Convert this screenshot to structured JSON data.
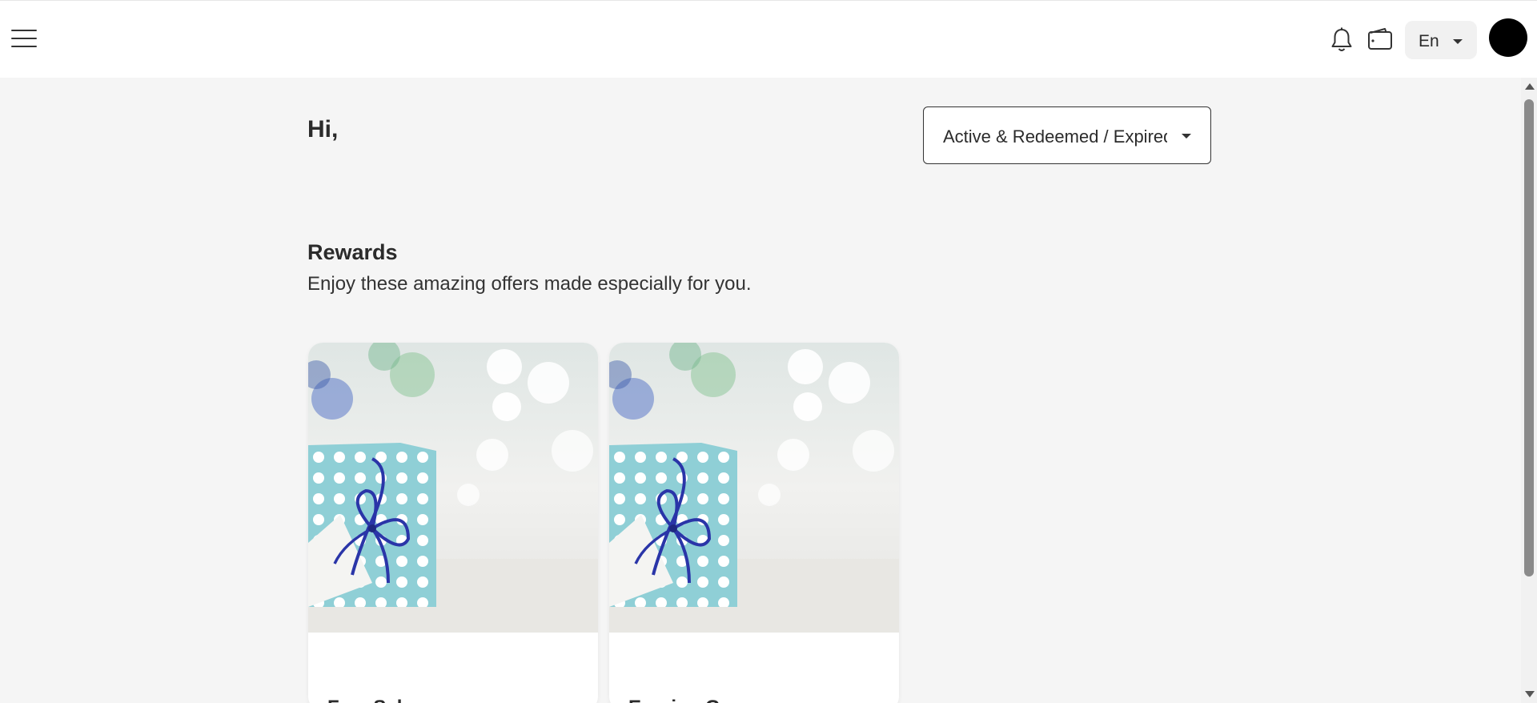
{
  "header": {
    "menu_icon": "hamburger-menu-icon",
    "notification_icon": "bell-icon",
    "wallet_icon": "wallet-icon",
    "language": "En"
  },
  "greeting": "Hi,",
  "filter": {
    "selected": "Active & Redeemed / Expired"
  },
  "rewards": {
    "title": "Rewards",
    "subtitle": "Enjoy these amazing offers made especially for you.",
    "cards": [
      {
        "title": "Free Sel",
        "image": "gift-box-image"
      },
      {
        "title": "Earning G",
        "image": "gift-box-image"
      }
    ]
  },
  "colors": {
    "background": "#f5f5f5",
    "header": "#ffffff",
    "gift_box": "#8fcfd6",
    "ribbon": "#2a35a8"
  }
}
